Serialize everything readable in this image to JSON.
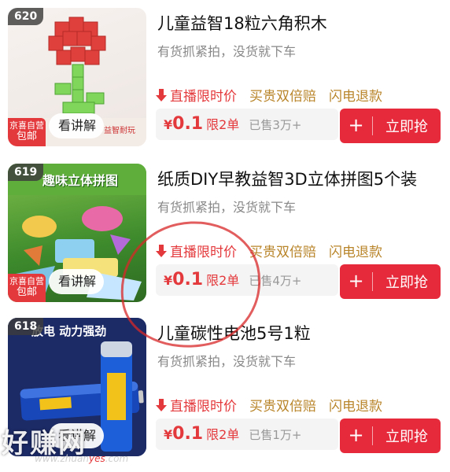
{
  "products": [
    {
      "rank": "620",
      "title": "儿童益智18粒六角积木",
      "subtitle": "有货抓紧拍，没货就下车",
      "tags": {
        "live": "直播限时价",
        "double": "买贵双倍赔",
        "refund": "闪电退款"
      },
      "price_symbol": "¥",
      "price": "0.1",
      "limit": "限2单",
      "sold": "已售3万+",
      "plus": "+",
      "buy": "立即抢",
      "watch": "看讲解",
      "jd_badge_line1": "京喜自营",
      "jd_badge_line2": "包邮",
      "image_text": "益智耐玩"
    },
    {
      "rank": "619",
      "title": "纸质DIY早教益智3D立体拼图5个装",
      "subtitle": "有货抓紧拍，没货就下车",
      "tags": {
        "live": "直播限时价",
        "double": "买贵双倍赔",
        "refund": "闪电退款"
      },
      "price_symbol": "¥",
      "price": "0.1",
      "limit": "限2单",
      "sold": "已售4万+",
      "plus": "+",
      "buy": "立即抢",
      "watch": "看讲解",
      "jd_badge_line1": "京喜自营",
      "jd_badge_line2": "包邮",
      "image_text": "趣味立体拼图"
    },
    {
      "rank": "618",
      "title": "儿童碳性电池5号1粒",
      "subtitle": "有货抓紧拍，没货就下车",
      "tags": {
        "live": "直播限时价",
        "double": "买贵双倍赔",
        "refund": "闪电退款"
      },
      "price_symbol": "¥",
      "price": "0.1",
      "limit": "限2单",
      "sold": "已售1万+",
      "plus": "+",
      "buy": "立即抢",
      "watch": "看讲解",
      "image_text": "放电 动力强劲"
    }
  ],
  "watermark": {
    "cn": "好赚网",
    "url_prefix": "www.zhuan",
    "url_yes": "yes",
    "url_suffix": ".com"
  },
  "colors": {
    "accent": "#e4393c",
    "gold": "#b9852a",
    "muted": "#888888"
  }
}
